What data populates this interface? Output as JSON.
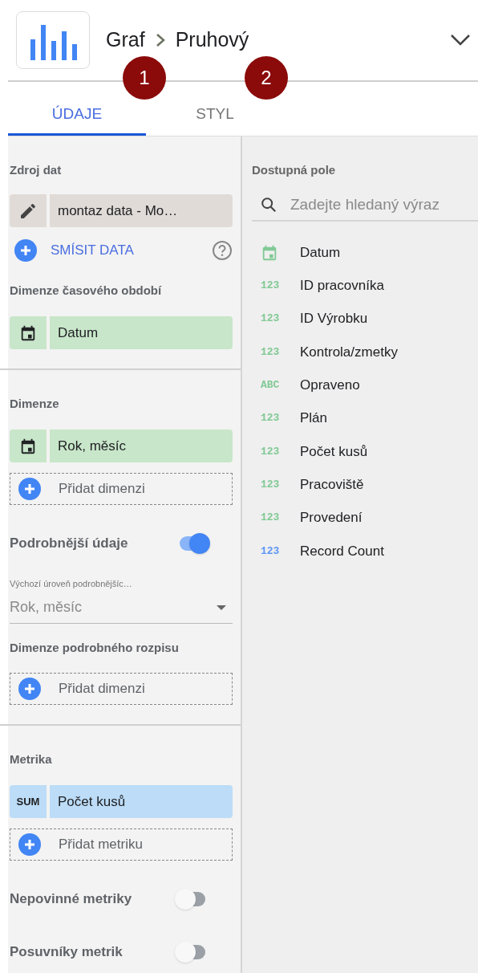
{
  "header": {
    "breadcrumb": [
      "Graf",
      "Pruhový"
    ]
  },
  "callouts": [
    "1",
    "2"
  ],
  "tabs": [
    {
      "label": "ÚDAJE",
      "selected": true
    },
    {
      "label": "STYL",
      "selected": false
    }
  ],
  "data_panel": [
    {
      "kind": "heading",
      "text": "Zdroj dat"
    },
    {
      "kind": "source",
      "text": "montaz data - Mo…"
    },
    {
      "kind": "action",
      "text": "SMÍSIT DATA"
    },
    {
      "kind": "heading",
      "text": "Dimenze časového období"
    },
    {
      "kind": "date_chip",
      "text": "Datum"
    },
    {
      "kind": "divider"
    },
    {
      "kind": "heading",
      "text": "Dimenze"
    },
    {
      "kind": "date_chip",
      "text": "Rok, měsíc"
    },
    {
      "kind": "add",
      "text": "Přidat dimenzi"
    },
    {
      "kind": "toggle",
      "text": "Podrobnější údaje",
      "on": true
    },
    {
      "kind": "select",
      "label": "Výchozí úroveň podrobnějšíc…",
      "value": "Rok, měsíc"
    },
    {
      "kind": "heading",
      "text": "Dimenze podrobného rozpisu"
    },
    {
      "kind": "add",
      "text": "Přidat dimenzi"
    },
    {
      "kind": "divider"
    },
    {
      "kind": "heading",
      "text": "Metrika"
    },
    {
      "kind": "metric_chip",
      "aggregation": "SUM",
      "text": "Počet kusů"
    },
    {
      "kind": "add",
      "text": "Přidat metriku"
    },
    {
      "kind": "toggle",
      "text": "Nepovinné metriky",
      "on": false
    },
    {
      "kind": "toggle",
      "text": "Posuvníky metrik",
      "on": false
    }
  ],
  "fields_panel": {
    "title": "Dostupná pole",
    "search": {
      "placeholder": "Zadejte hledaný výraz"
    },
    "fields": [
      {
        "kind": "date",
        "name": "Datum",
        "color": "#81c995"
      },
      {
        "kind": "typed",
        "type_label": "123",
        "name": "ID pracovníka",
        "color": "#81c995"
      },
      {
        "kind": "typed",
        "type_label": "123",
        "name": "ID Výrobku",
        "color": "#81c995"
      },
      {
        "kind": "typed",
        "type_label": "123",
        "name": "Kontrola/zmetky",
        "color": "#81c995"
      },
      {
        "kind": "typed",
        "type_label": "ABC",
        "name": "Opraveno",
        "color": "#81c995"
      },
      {
        "kind": "typed",
        "type_label": "123",
        "name": "Plán",
        "color": "#81c995"
      },
      {
        "kind": "typed",
        "type_label": "123",
        "name": "Počet kusů",
        "color": "#81c995"
      },
      {
        "kind": "typed",
        "type_label": "123",
        "name": "Pracoviště",
        "color": "#81c995"
      },
      {
        "kind": "typed",
        "type_label": "123",
        "name": "Provedení",
        "color": "#81c995"
      },
      {
        "kind": "typed",
        "type_label": "123",
        "name": "Record Count",
        "color": "#5e97f6"
      }
    ]
  }
}
